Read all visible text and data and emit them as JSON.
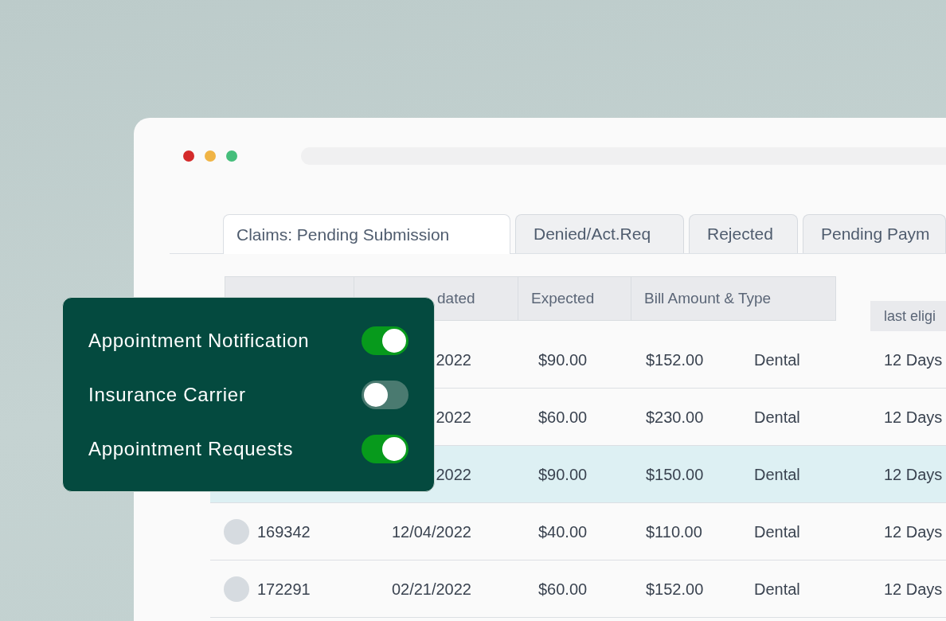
{
  "tabs": [
    {
      "label": "Claims: Pending Submission",
      "selected": true
    },
    {
      "label": "Denied/Act.Req",
      "selected": false
    },
    {
      "label": "Rejected",
      "selected": false
    },
    {
      "label": "Pending Paym",
      "selected": false
    }
  ],
  "table": {
    "columns": [
      {},
      {
        "label": "dated"
      },
      {
        "label": "Expected"
      },
      {
        "label": "Bill Amount & Type"
      }
    ],
    "column_6": {
      "label": "last eligi"
    },
    "rows": [
      {
        "selected": false,
        "column_2": "2022",
        "expected": "$90.00",
        "bill_amount": "$152.00",
        "bill_type": "Dental",
        "column_6": "12 Days"
      },
      {
        "selected": false,
        "column_2": "2022",
        "expected": "$60.00",
        "bill_amount": "$230.00",
        "bill_type": "Dental",
        "column_6": "12 Days"
      },
      {
        "selected": true,
        "column_2": "2022",
        "expected": "$90.00",
        "bill_amount": "$150.00",
        "bill_type": "Dental",
        "column_6": "12 Days"
      },
      {
        "selected": false,
        "column_1": "169342",
        "column_2": "12/04/2022",
        "expected": "$40.00",
        "bill_amount": "$110.00",
        "bill_type": "Dental",
        "column_6": "12 Days"
      },
      {
        "selected": false,
        "column_1": "172291",
        "column_2": "02/21/2022",
        "expected": "$60.00",
        "bill_amount": "$152.00",
        "bill_type": "Dental",
        "column_6": "12 Days"
      }
    ]
  },
  "settings_popup": {
    "settings": [
      {
        "label": "Appointment Notification",
        "on": true
      },
      {
        "label": "Insurance Carrier",
        "on": false
      },
      {
        "label": "Appointment Requests",
        "on": true
      }
    ]
  }
}
